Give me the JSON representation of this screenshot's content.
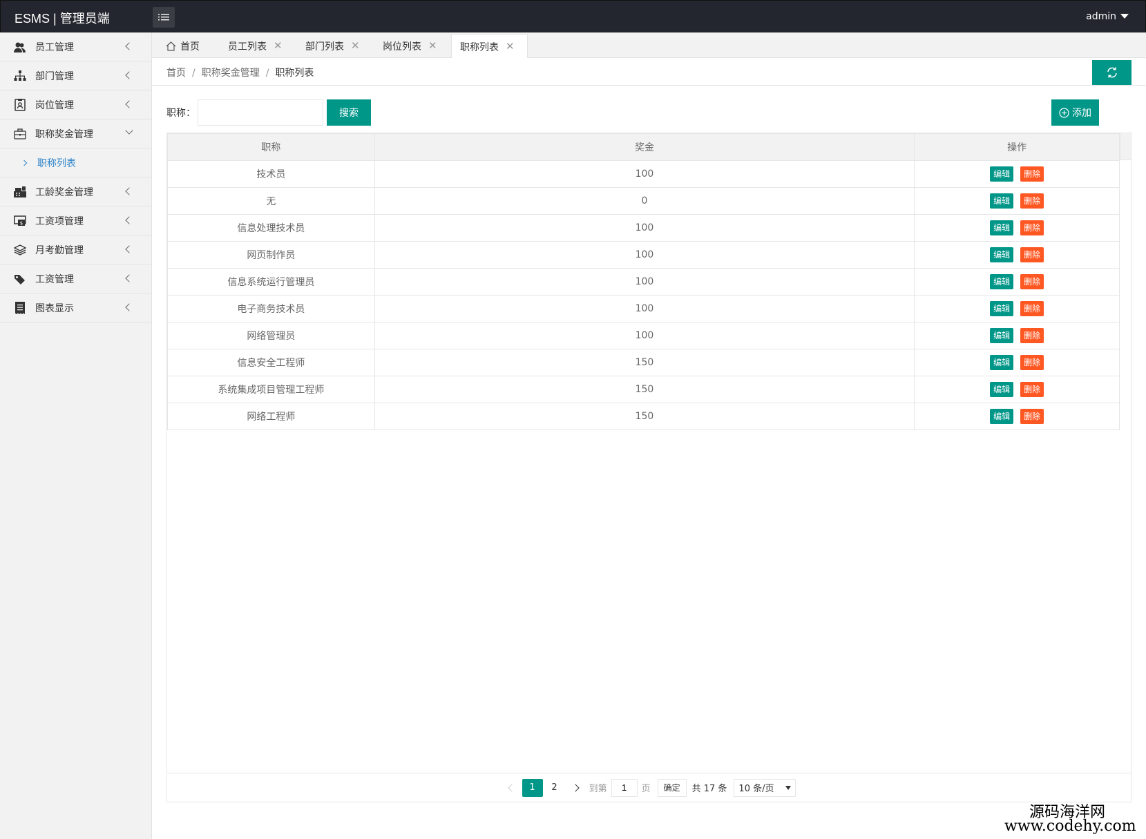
{
  "header": {
    "logo": "ESMS | 管理员端",
    "user": "admin"
  },
  "sidebar": {
    "items": [
      {
        "label": "员工管理",
        "icon": "users-icon",
        "expanded": false
      },
      {
        "label": "部门管理",
        "icon": "sitemap-icon",
        "expanded": false
      },
      {
        "label": "岗位管理",
        "icon": "id-card-icon",
        "expanded": false
      },
      {
        "label": "职称奖金管理",
        "icon": "briefcase-icon",
        "expanded": true
      },
      {
        "label": "工龄奖金管理",
        "icon": "cash-register-icon",
        "expanded": false
      },
      {
        "label": "工资项管理",
        "icon": "money-slip-icon",
        "expanded": false
      },
      {
        "label": "月考勤管理",
        "icon": "layers-icon",
        "expanded": false
      },
      {
        "label": "工资管理",
        "icon": "tags-icon",
        "expanded": false
      },
      {
        "label": "图表显示",
        "icon": "receipt-icon",
        "expanded": false
      }
    ],
    "subitem": "职称列表"
  },
  "tabs": [
    {
      "label": "首页",
      "closable": false
    },
    {
      "label": "员工列表",
      "closable": true
    },
    {
      "label": "部门列表",
      "closable": true
    },
    {
      "label": "岗位列表",
      "closable": true
    },
    {
      "label": "职称列表",
      "closable": true,
      "active": true
    }
  ],
  "breadcrumb": [
    "首页",
    "职称奖金管理",
    "职称列表"
  ],
  "search": {
    "label": "职称：",
    "value": "",
    "button": "搜索"
  },
  "add_button": "添加",
  "table": {
    "columns": [
      "职称",
      "奖金",
      "操作"
    ],
    "rows": [
      {
        "title": "技术员",
        "bonus": "100"
      },
      {
        "title": "无",
        "bonus": "0"
      },
      {
        "title": "信息处理技术员",
        "bonus": "100"
      },
      {
        "title": "网页制作员",
        "bonus": "100"
      },
      {
        "title": "信息系统运行管理员",
        "bonus": "100"
      },
      {
        "title": "电子商务技术员",
        "bonus": "100"
      },
      {
        "title": "网络管理员",
        "bonus": "100"
      },
      {
        "title": "信息安全工程师",
        "bonus": "150"
      },
      {
        "title": "系统集成项目管理工程师",
        "bonus": "150"
      },
      {
        "title": "网络工程师",
        "bonus": "150"
      }
    ],
    "edit_label": "编辑",
    "delete_label": "删除"
  },
  "pagination": {
    "pages": [
      "1",
      "2"
    ],
    "current": "1",
    "goto_label": "到第",
    "goto_value": "1",
    "page_unit": "页",
    "confirm": "确定",
    "total": "共 17 条",
    "page_size": "10 条/页"
  },
  "watermark": {
    "line1": "源码海洋网",
    "line2": "www.codehy.com"
  },
  "colors": {
    "header_bg": "#23262e",
    "primary": "#009688",
    "danger": "#ff5722",
    "link": "#2f84c9"
  }
}
